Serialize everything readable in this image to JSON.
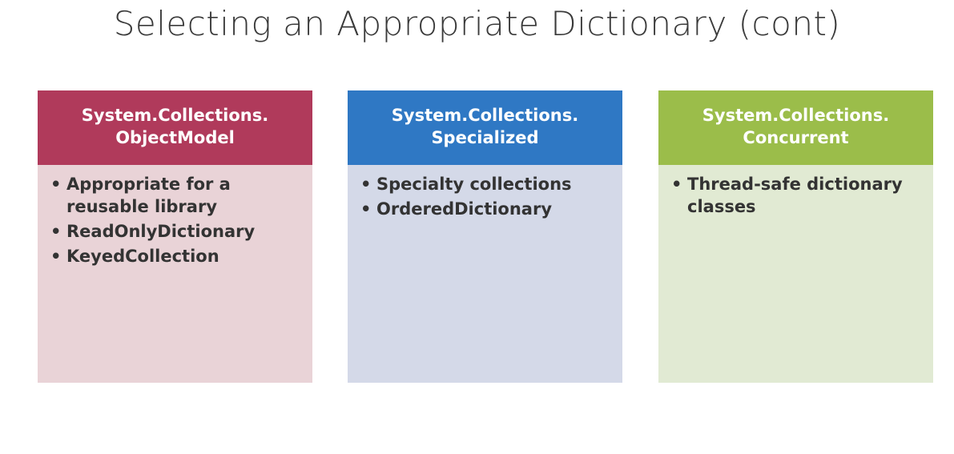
{
  "slide": {
    "title": "Selecting an Appropriate Dictionary (cont)"
  },
  "cards": [
    {
      "header_line1": "System.Collections.",
      "header_line2": "ObjectModel",
      "header_color": "#b03a5b",
      "body_color": "#e9d3d7",
      "bullets": [
        "Appropriate for a reusable library",
        "ReadOnlyDictionary",
        "KeyedCollection"
      ]
    },
    {
      "header_line1": "System.Collections.",
      "header_line2": "Specialized",
      "header_color": "#2f78c4",
      "body_color": "#d4d9e8",
      "bullets": [
        "Specialty collections",
        "OrderedDictionary"
      ]
    },
    {
      "header_line1": "System.Collections.",
      "header_line2": "Concurrent",
      "header_color": "#9bbd4a",
      "body_color": "#e1ead3",
      "bullets": [
        "Thread-safe dictionary classes"
      ]
    }
  ]
}
